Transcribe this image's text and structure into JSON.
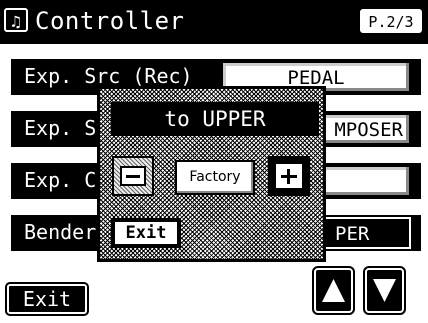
{
  "title_bar": {
    "icon": "music-note-icon",
    "title": "Controller",
    "page": "P.2/3"
  },
  "rows": [
    {
      "label": "Exp. Src (Rec)",
      "value": "PEDAL"
    },
    {
      "label": "Exp. Sr",
      "value": "MPOSER"
    },
    {
      "label": "Exp. Cu",
      "value": ""
    },
    {
      "label": "Bender",
      "value": "PER"
    }
  ],
  "popup": {
    "title": "to UPPER",
    "minus_icon": "minus-icon",
    "factory_label": "Factory",
    "plus_icon": "plus-icon",
    "exit_label": "Exit"
  },
  "bottom": {
    "exit_label": "Exit",
    "up_icon": "up-triangle-icon",
    "down_icon": "down-triangle-icon"
  }
}
